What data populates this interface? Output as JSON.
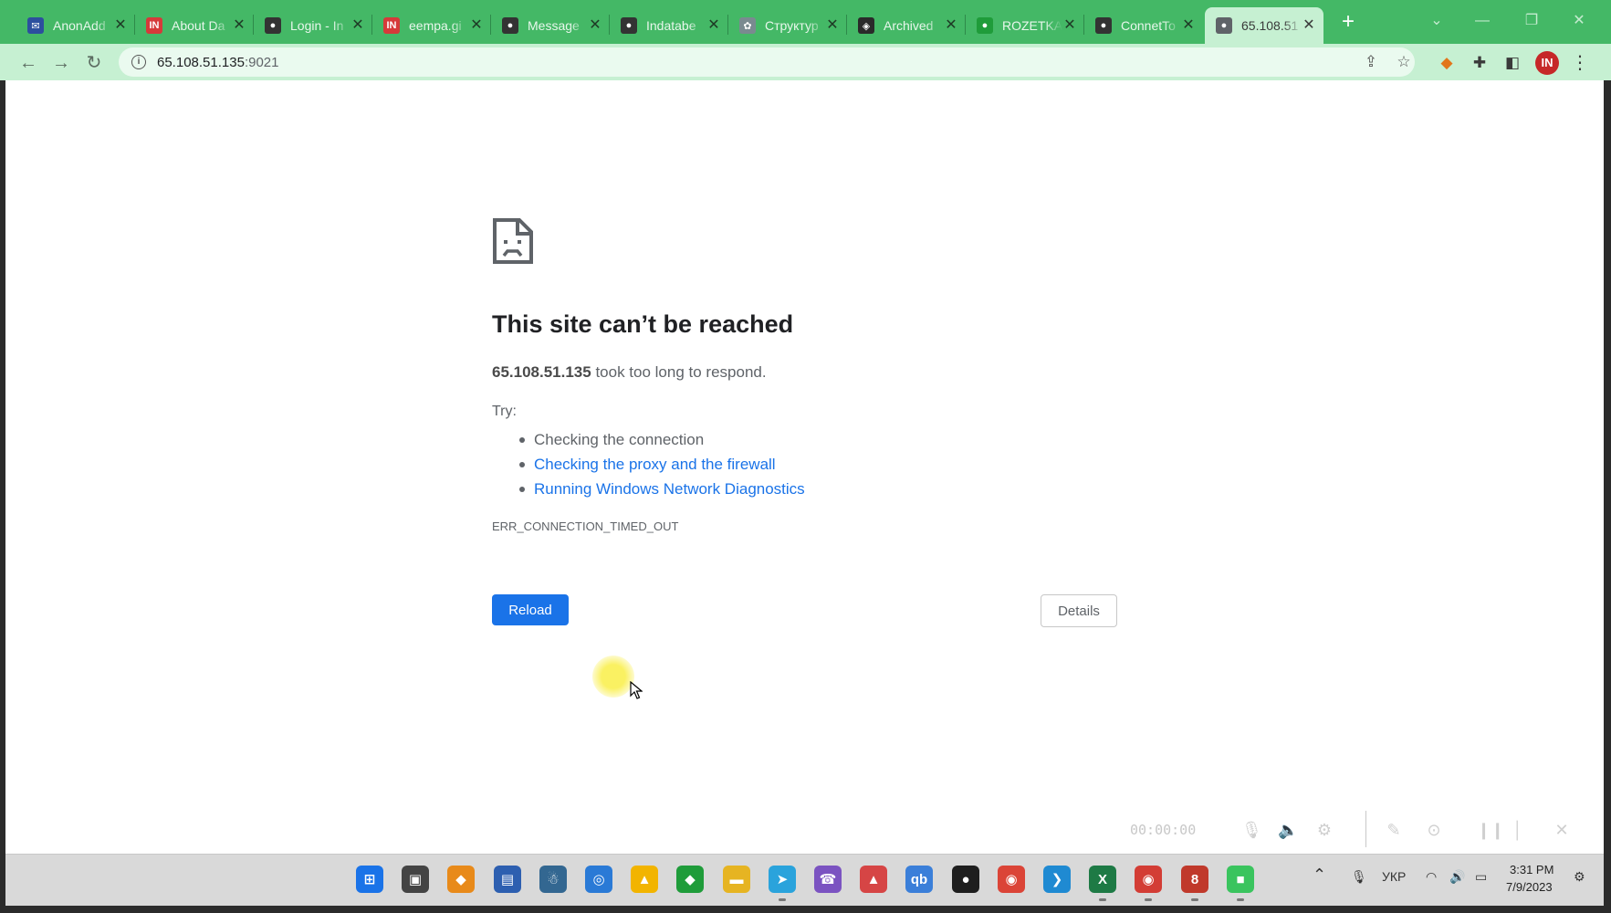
{
  "browser": {
    "tabs": [
      {
        "title": "AnonAdd",
        "icon": "mail-icon",
        "color": "#2c4f9e",
        "glyph": "✉"
      },
      {
        "title": "About Da",
        "icon": "indeed-icon",
        "color": "#d63a3a",
        "glyph": "IN"
      },
      {
        "title": "Login - In",
        "icon": "globe-icon",
        "color": "#333333",
        "glyph": "●"
      },
      {
        "title": "eempa.gi",
        "icon": "indeed-icon",
        "color": "#d63a3a",
        "glyph": "IN"
      },
      {
        "title": "Message",
        "icon": "globe-icon",
        "color": "#333333",
        "glyph": "●"
      },
      {
        "title": "Indatabe",
        "icon": "globe-icon",
        "color": "#333333",
        "glyph": "●"
      },
      {
        "title": "Структур",
        "icon": "openai-icon",
        "color": "#7a8a90",
        "glyph": "✿"
      },
      {
        "title": "Archived",
        "icon": "archive-icon",
        "color": "#2a2a2a",
        "glyph": "◈"
      },
      {
        "title": "ROZETKA",
        "icon": "rozetka-icon",
        "color": "#1f9c3a",
        "glyph": "●"
      },
      {
        "title": "ConnetTo",
        "icon": "globe-icon",
        "color": "#333333",
        "glyph": "●"
      },
      {
        "title": "65.108.51",
        "icon": "globe-icon",
        "color": "#5f6368",
        "glyph": "●"
      }
    ],
    "url_host": "65.108.51.135",
    "url_port": ":9021"
  },
  "error_page": {
    "title": "This site can’t be reached",
    "host": "65.108.51.135",
    "message": " took too long to respond.",
    "try_label": "Try:",
    "suggestions": [
      {
        "text": "Checking the connection",
        "link": false
      },
      {
        "text": "Checking the proxy and the firewall",
        "link": true
      },
      {
        "text": "Running Windows Network Diagnostics",
        "link": true
      }
    ],
    "error_code": "ERR_CONNECTION_TIMED_OUT",
    "reload_label": "Reload",
    "details_label": "Details"
  },
  "recorder": {
    "time": "00:00:00"
  },
  "taskbar": {
    "apps": [
      {
        "name": "start-icon",
        "color": "#1a73e8",
        "glyph": "⊞"
      },
      {
        "name": "task-view-icon",
        "color": "#444444",
        "glyph": "▣"
      },
      {
        "name": "app-fox-icon",
        "color": "#e88a1a",
        "glyph": "◆"
      },
      {
        "name": "app-network-icon",
        "color": "#2d5fb0",
        "glyph": "▤"
      },
      {
        "name": "postgres-icon",
        "color": "#336791",
        "glyph": "☃"
      },
      {
        "name": "app-blue-icon",
        "color": "#2a7ad6",
        "glyph": "◎"
      },
      {
        "name": "app-warning-icon",
        "color": "#f2b400",
        "glyph": "▲"
      },
      {
        "name": "app-green-icon",
        "color": "#1f9c3a",
        "glyph": "◆"
      },
      {
        "name": "file-explorer-icon",
        "color": "#e6b422",
        "glyph": "▬"
      },
      {
        "name": "telegram-icon",
        "color": "#2aa3dc",
        "glyph": "➤"
      },
      {
        "name": "viber-icon",
        "color": "#7b53c1",
        "glyph": "☎"
      },
      {
        "name": "app-triangle-icon",
        "color": "#d64545",
        "glyph": "▲"
      },
      {
        "name": "qbittorrent-icon",
        "color": "#3b7fd9",
        "glyph": "qb"
      },
      {
        "name": "figma-icon",
        "color": "#1e1e1e",
        "glyph": "●"
      },
      {
        "name": "chrome-icon",
        "color": "#db4437",
        "glyph": "◉"
      },
      {
        "name": "vscode-icon",
        "color": "#1f8ad2",
        "glyph": "❯"
      },
      {
        "name": "excel-icon",
        "color": "#1e7a45",
        "glyph": "X"
      },
      {
        "name": "chrome-profile-icon",
        "color": "#d33d35",
        "glyph": "◉"
      },
      {
        "name": "chrome-profile2-icon",
        "color": "#c0392b",
        "glyph": "8"
      },
      {
        "name": "app-green2-icon",
        "color": "#3ac45e",
        "glyph": "■"
      }
    ],
    "lang": "УКР",
    "time": "3:31 PM",
    "date": "7/9/2023"
  }
}
